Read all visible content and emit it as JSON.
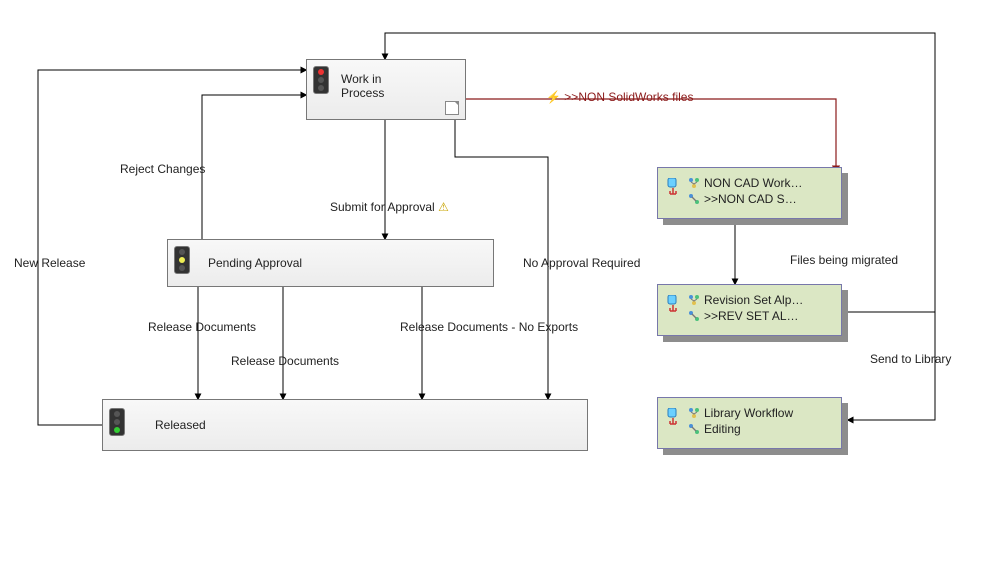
{
  "states": {
    "wip": {
      "label": "Work in\nProcess",
      "light": "red"
    },
    "pending": {
      "label": "Pending Approval",
      "light": "yellow"
    },
    "released": {
      "label": "Released",
      "light": "green"
    }
  },
  "cards": {
    "noncad": {
      "line1": "NON  CAD Work…",
      "line2": ">>NON  CAD S…"
    },
    "revset": {
      "line1": "Revision  Set Alp…",
      "line2": ">>REV  SET AL…"
    },
    "library": {
      "line1": "Library Workflow",
      "line2": "Editing"
    }
  },
  "edges": {
    "reject": "Reject Changes",
    "submit": "Submit for Approval",
    "noapprove": "No Approval Required",
    "release1": "Release Documents",
    "release2": "Release Documents",
    "release3": "Release Documents - No Exports",
    "newrel": "New Release",
    "nonsw": ">>NON SolidWorks files",
    "migrate": "Files being migrated",
    "sendlib": "Send to Library"
  },
  "colors": {
    "red_line": "#8b1a1a"
  },
  "icons": {
    "bolt": "⚡",
    "warn": "⚠"
  }
}
